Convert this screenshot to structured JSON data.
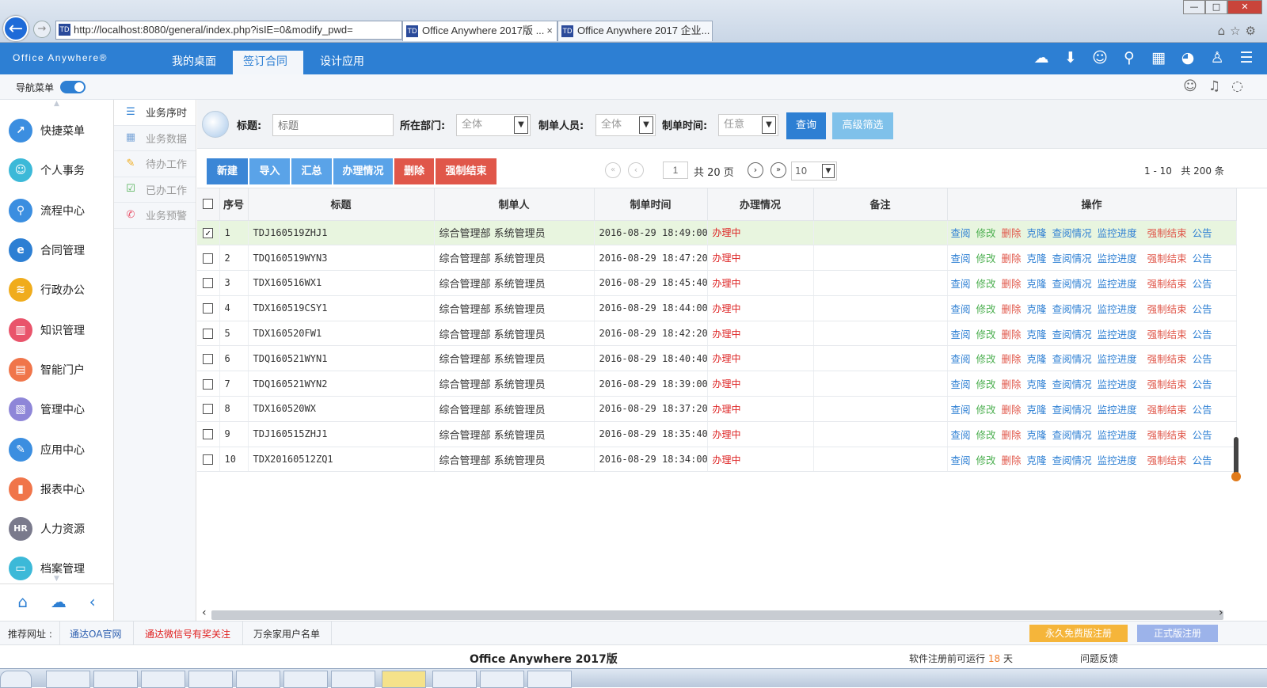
{
  "browser": {
    "url": "http://localhost:8080/general/index.php?isIE=0&modify_pwd=",
    "tabs": [
      {
        "title": "Office Anywhere 2017版 ...",
        "close": "×",
        "active": true
      },
      {
        "title": "Office Anywhere 2017 企业...",
        "active": false
      }
    ],
    "window_controls": [
      "—",
      "□",
      "✕"
    ]
  },
  "app": {
    "logo": "Office Anywhere®",
    "menu_tabs": [
      {
        "label": "我的桌面",
        "active": false
      },
      {
        "label": "签订合同",
        "active": true,
        "close": "×"
      },
      {
        "label": "设计应用",
        "active": false
      }
    ],
    "header_icons": [
      "cloud-icon",
      "download-icon",
      "user-icon",
      "search-icon",
      "apps-icon",
      "theme-icon",
      "shirt-icon",
      "menu-icon"
    ]
  },
  "nav": {
    "label": "导航菜单",
    "toggle_on": true
  },
  "sidebar": {
    "items": [
      {
        "label": "快捷菜单",
        "color": "#3b8ee0",
        "glyph": "↗"
      },
      {
        "label": "个人事务",
        "color": "#3cb9d8",
        "glyph": "☺"
      },
      {
        "label": "流程中心",
        "color": "#3b8ee0",
        "glyph": "⚲"
      },
      {
        "label": "合同管理",
        "color": "#2d7fd3",
        "glyph": "e"
      },
      {
        "label": "行政办公",
        "color": "#f0ac1c",
        "glyph": "≋"
      },
      {
        "label": "知识管理",
        "color": "#e9546b",
        "glyph": "▥"
      },
      {
        "label": "智能门户",
        "color": "#f0754a",
        "glyph": "▤"
      },
      {
        "label": "管理中心",
        "color": "#8e86d8",
        "glyph": "▧"
      },
      {
        "label": "应用中心",
        "color": "#3b8ee0",
        "glyph": "✎"
      },
      {
        "label": "报表中心",
        "color": "#f0754a",
        "glyph": "▮"
      },
      {
        "label": "人力资源",
        "color": "#7a7a8c",
        "glyph": "HR"
      },
      {
        "label": "档案管理",
        "color": "#3cb9d8",
        "glyph": "▭"
      }
    ]
  },
  "subnav": {
    "items": [
      {
        "label": "业务序时",
        "active": true,
        "color": "#2d7fd3",
        "glyph": "☰"
      },
      {
        "label": "业务数据",
        "active": false,
        "color": "#7ba6d8",
        "glyph": "▦"
      },
      {
        "label": "待办工作",
        "active": false,
        "color": "#f0ac1c",
        "glyph": "✎"
      },
      {
        "label": "已办工作",
        "active": false,
        "color": "#4caf50",
        "glyph": "☑"
      },
      {
        "label": "业务预警",
        "active": false,
        "color": "#e9546b",
        "glyph": "✆"
      }
    ]
  },
  "filter": {
    "title_label": "标题:",
    "title_placeholder": "标题",
    "dept_label": "所在部门:",
    "dept_value": "全体",
    "maker_label": "制单人员:",
    "maker_value": "全体",
    "time_label": "制单时间:",
    "time_value": "任意",
    "query_label": "查询",
    "advanced_label": "高级筛选"
  },
  "toolbar": {
    "buttons": [
      {
        "label": "新建",
        "color": "#3b86d6"
      },
      {
        "label": "导入",
        "color": "#5aa3e8"
      },
      {
        "label": "汇总",
        "color": "#5aa3e8"
      },
      {
        "label": "办理情况",
        "color": "#5aa3e8"
      },
      {
        "label": "删除",
        "color": "#e0574a"
      },
      {
        "label": "强制结束",
        "color": "#e0574a"
      }
    ],
    "pager": {
      "page": "1",
      "total_pages_label": "共 20 页",
      "page_size": "10",
      "range": "1 - 10",
      "total_label": "共 200 条"
    }
  },
  "table": {
    "headers": [
      "序号",
      "标题",
      "制单人",
      "制单时间",
      "办理情况",
      "备注",
      "操作"
    ],
    "rows": [
      {
        "no": "1",
        "title": "TDJ160519ZHJ1",
        "maker": "综合管理部  系统管理员",
        "time": "2016-08-29 18:49:00",
        "status": "办理中",
        "note": "",
        "checked": true
      },
      {
        "no": "2",
        "title": "TDQ160519WYN3",
        "maker": "综合管理部  系统管理员",
        "time": "2016-08-29 18:47:20",
        "status": "办理中",
        "note": "",
        "checked": false
      },
      {
        "no": "3",
        "title": "TDX160516WX1",
        "maker": "综合管理部  系统管理员",
        "time": "2016-08-29 18:45:40",
        "status": "办理中",
        "note": "",
        "checked": false
      },
      {
        "no": "4",
        "title": "TDX160519CSY1",
        "maker": "综合管理部  系统管理员",
        "time": "2016-08-29 18:44:00",
        "status": "办理中",
        "note": "",
        "checked": false
      },
      {
        "no": "5",
        "title": "TDX160520FW1",
        "maker": "综合管理部  系统管理员",
        "time": "2016-08-29 18:42:20",
        "status": "办理中",
        "note": "",
        "checked": false
      },
      {
        "no": "6",
        "title": "TDQ160521WYN1",
        "maker": "综合管理部  系统管理员",
        "time": "2016-08-29 18:40:40",
        "status": "办理中",
        "note": "",
        "checked": false
      },
      {
        "no": "7",
        "title": "TDQ160521WYN2",
        "maker": "综合管理部  系统管理员",
        "time": "2016-08-29 18:39:00",
        "status": "办理中",
        "note": "",
        "checked": false
      },
      {
        "no": "8",
        "title": "TDX160520WX",
        "maker": "综合管理部  系统管理员",
        "time": "2016-08-29 18:37:20",
        "status": "办理中",
        "note": "",
        "checked": false
      },
      {
        "no": "9",
        "title": "TDJ160515ZHJ1",
        "maker": "综合管理部  系统管理员",
        "time": "2016-08-29 18:35:40",
        "status": "办理中",
        "note": "",
        "checked": false
      },
      {
        "no": "10",
        "title": "TDX20160512ZQ1",
        "maker": "综合管理部  系统管理员",
        "time": "2016-08-29 18:34:00",
        "status": "办理中",
        "note": "",
        "checked": false
      }
    ],
    "actions": [
      {
        "label": "查阅",
        "color": "#2d7fd3"
      },
      {
        "label": "修改",
        "color": "#4caf50"
      },
      {
        "label": "删除",
        "color": "#e0574a"
      },
      {
        "label": "克隆",
        "color": "#2d7fd3"
      },
      {
        "label": "查阅情况",
        "color": "#2d7fd3"
      },
      {
        "label": "监控进度",
        "color": "#2d7fd3"
      },
      {
        "label": "强制结束",
        "color": "#e0574a"
      },
      {
        "label": "公告",
        "color": "#2d7fd3"
      }
    ]
  },
  "footer": {
    "recommend_label": "推荐网址 :",
    "links": [
      {
        "label": "通达OA官网",
        "color": "#2d5fb0"
      },
      {
        "label": "通达微信号有奖关注",
        "color": "#e02020"
      },
      {
        "label": "万余家用户名单",
        "color": "#333"
      }
    ],
    "free_reg_label": "永久免费版注册",
    "official_reg_label": "正式版注册",
    "product_name": "Office Anywhere 2017版",
    "trial_prefix": "软件注册前可运行",
    "trial_days": "18",
    "trial_suffix": "天",
    "feedback_label": "问题反馈"
  }
}
